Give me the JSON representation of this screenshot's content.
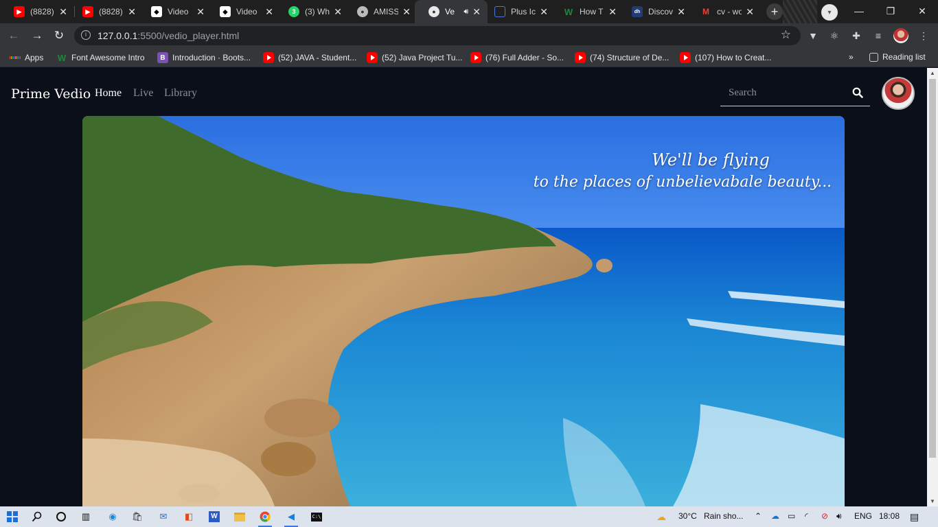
{
  "browser": {
    "tabs": [
      {
        "title": "(8828)",
        "icon": "youtube-icon",
        "color": "#ff0000"
      },
      {
        "title": "(8828)",
        "icon": "youtube-icon",
        "color": "#ff0000"
      },
      {
        "title": "Video",
        "icon": "video-icon",
        "color": "#ffffff"
      },
      {
        "title": "Video",
        "icon": "video-icon",
        "color": "#ffffff"
      },
      {
        "title": "(3) Wh",
        "icon": "whatsapp-icon",
        "color": "#25d366"
      },
      {
        "title": "AMISS",
        "icon": "globe-icon",
        "color": "#cccccc"
      },
      {
        "title": "Ve",
        "icon": "globe-icon",
        "color": "#cccccc"
      },
      {
        "title": "Plus Ic",
        "icon": "chat-icon",
        "color": "#4a7bd8"
      },
      {
        "title": "How T",
        "icon": "w-icon",
        "color": "#1b8a3a"
      },
      {
        "title": "Discov",
        "icon": "dh-icon",
        "color": "#233b74"
      },
      {
        "title": "cv - wo",
        "icon": "gmail-icon",
        "color": "#ea4335"
      }
    ],
    "active_tab_index": 6,
    "url_host": "127.0.0.1",
    "url_rest": ":5500/vedio_player.html",
    "bookmarks": [
      {
        "label": "Apps"
      },
      {
        "label": "Font Awesome Intro"
      },
      {
        "label": "Introduction · Boots..."
      },
      {
        "label": "(52) JAVA - Student..."
      },
      {
        "label": "(52) Java Project Tu..."
      },
      {
        "label": "(76) Full Adder - So..."
      },
      {
        "label": "(74) Structure of De..."
      },
      {
        "label": "(107) How to Creat..."
      }
    ],
    "overflow": "»",
    "reading_list": "Reading list"
  },
  "site": {
    "brand": "Prime Vedio",
    "nav": [
      {
        "label": "Home",
        "active": true
      },
      {
        "label": "Live",
        "active": false
      },
      {
        "label": "Library",
        "active": false
      }
    ],
    "search_placeholder": "Search"
  },
  "video": {
    "caption_line1": "We'll be flying",
    "caption_line2": "to the places of unbelievabale beauty..."
  },
  "taskbar": {
    "weather_temp": "30°C",
    "weather_text": "Rain sho...",
    "language": "ENG",
    "time": "18:08"
  }
}
